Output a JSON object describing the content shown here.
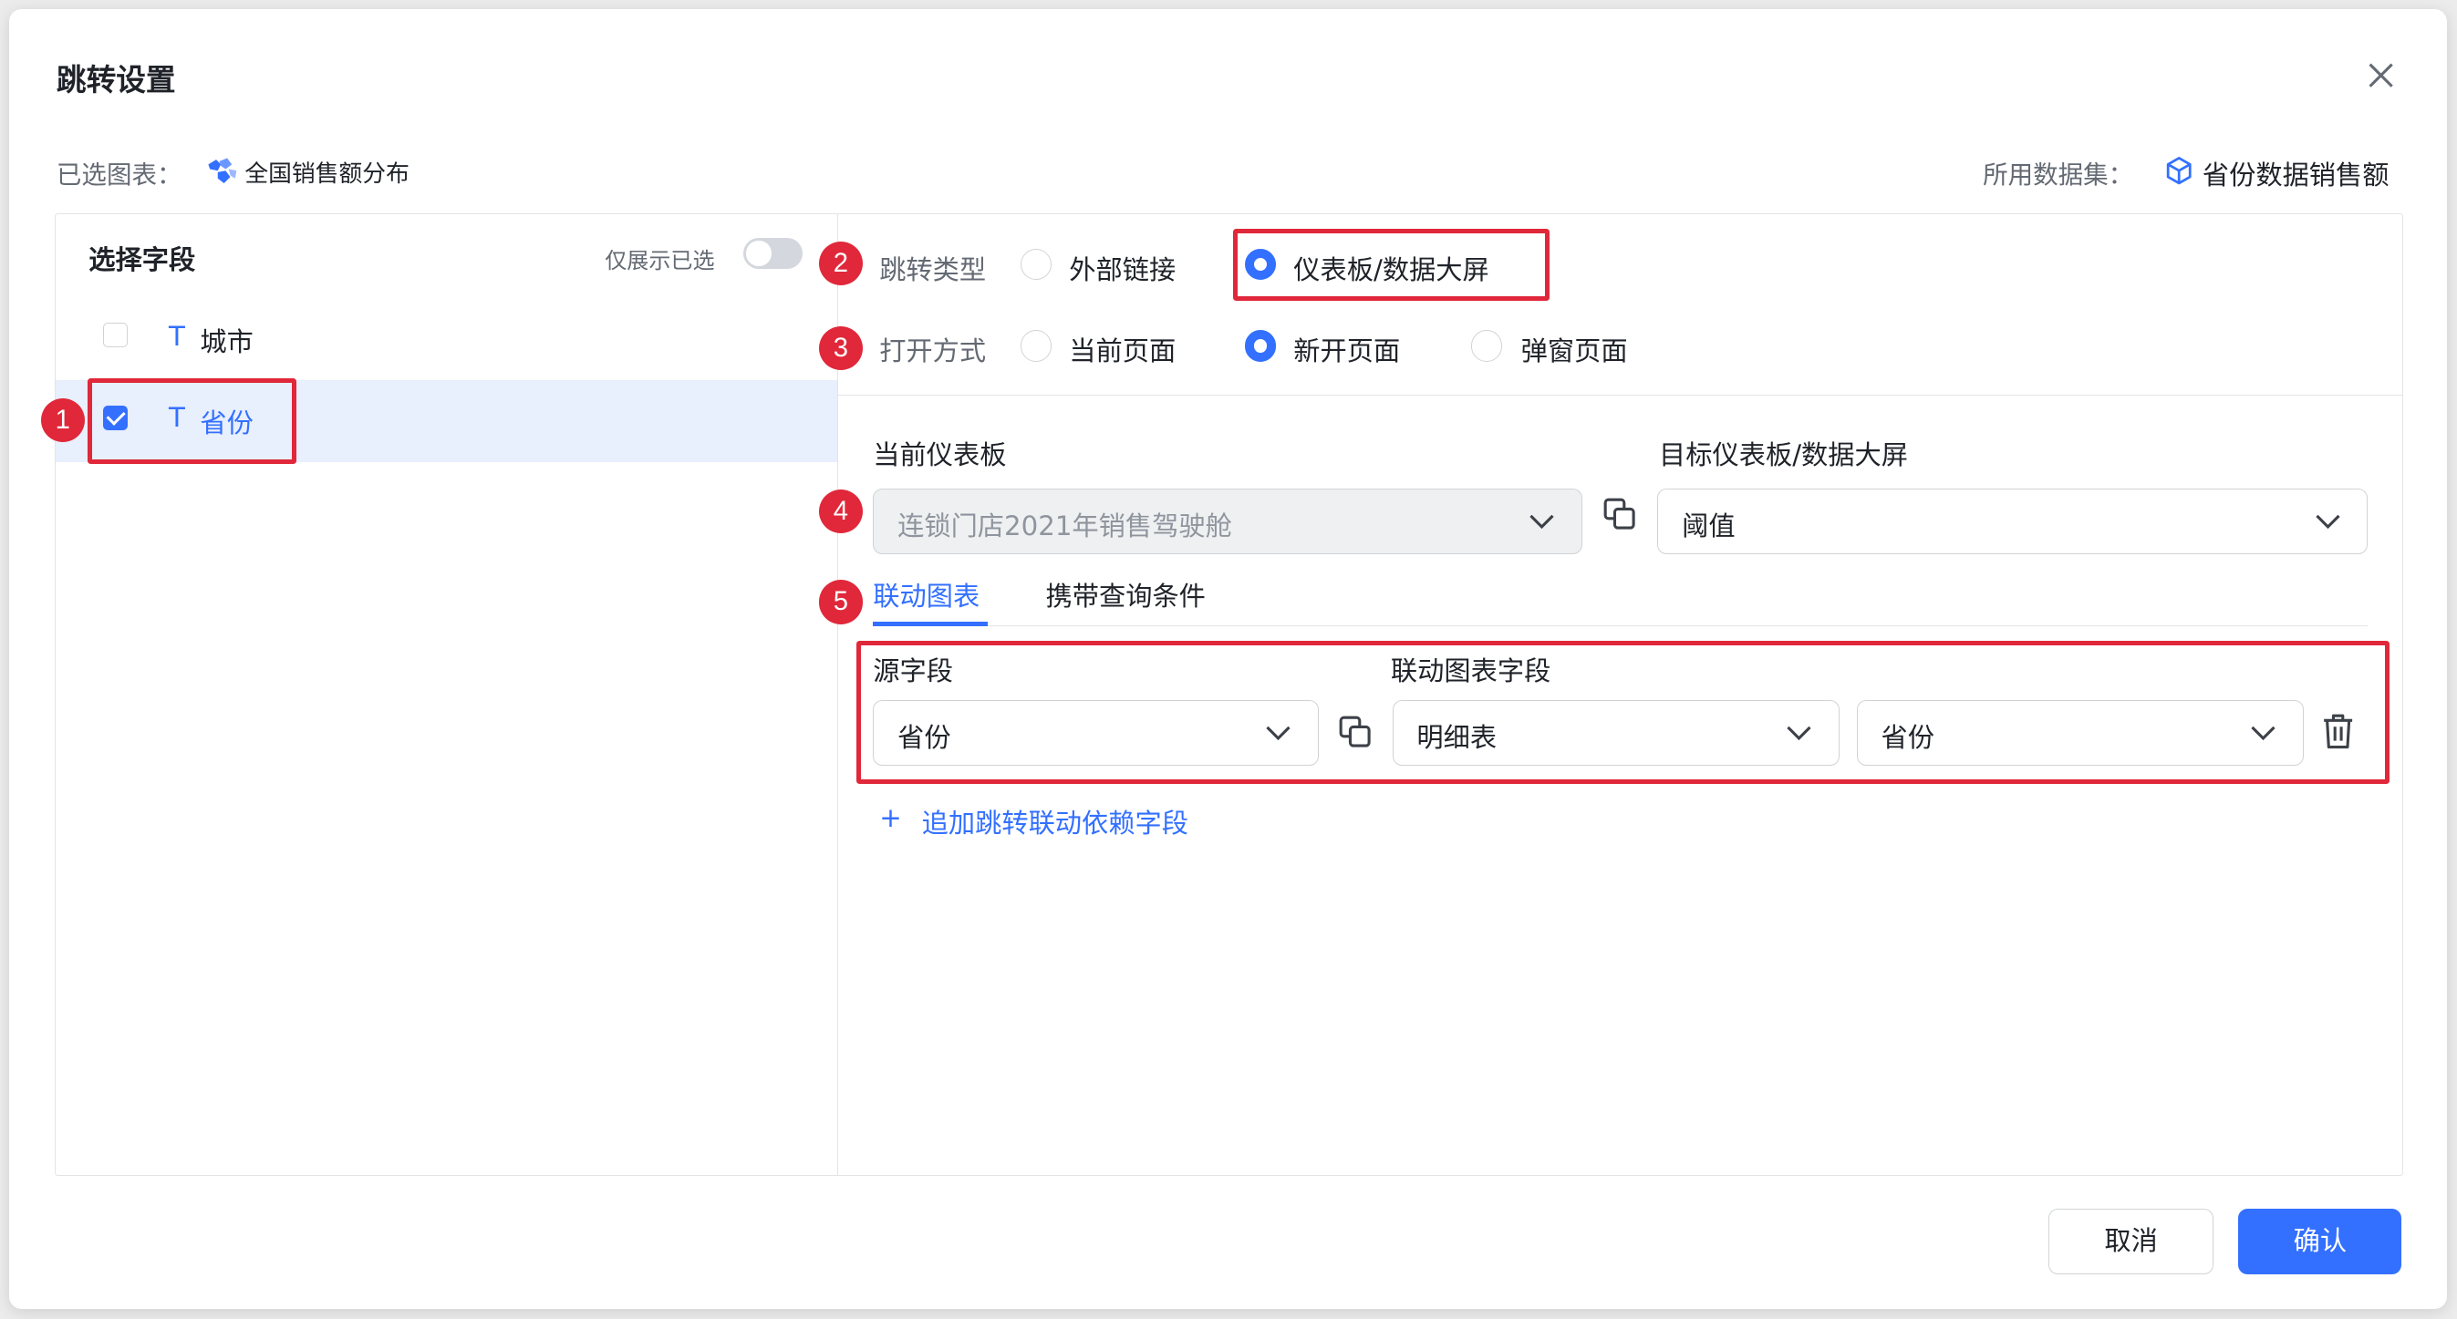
{
  "dialog": {
    "title": "跳转设置",
    "selected_chart_label": "已选图表：",
    "selected_chart_name": "全国销售额分布",
    "dataset_label": "所用数据集：",
    "dataset_name": "省份数据销售额"
  },
  "left_panel": {
    "heading": "选择字段",
    "only_selected_label": "仅展示已选",
    "only_selected_on": false,
    "fields": [
      {
        "type_icon": "T",
        "label": "城市",
        "checked": false
      },
      {
        "type_icon": "T",
        "label": "省份",
        "checked": true
      }
    ]
  },
  "badges": [
    "1",
    "2",
    "3",
    "4",
    "5"
  ],
  "jump_type": {
    "label": "跳转类型",
    "options": [
      {
        "label": "外部链接",
        "selected": false
      },
      {
        "label": "仪表板/数据大屏",
        "selected": true
      }
    ]
  },
  "open_mode": {
    "label": "打开方式",
    "options": [
      {
        "label": "当前页面",
        "selected": false
      },
      {
        "label": "新开页面",
        "selected": true
      },
      {
        "label": "弹窗页面",
        "selected": false
      }
    ]
  },
  "dashboards": {
    "current_label": "当前仪表板",
    "current_value": "连锁门店2021年销售驾驶舱",
    "target_label": "目标仪表板/数据大屏",
    "target_value": "阈值"
  },
  "tabs": [
    {
      "label": "联动图表",
      "active": true
    },
    {
      "label": "携带查询条件",
      "active": false
    }
  ],
  "mapping": {
    "source_label": "源字段",
    "target_label": "联动图表字段",
    "source_value": "省份",
    "chart_value": "明细表",
    "field_value": "省份"
  },
  "add_link": {
    "icon": "+",
    "label": "追加跳转联动依赖字段"
  },
  "footer": {
    "cancel": "取消",
    "confirm": "确认"
  },
  "colors": {
    "accent": "#3370ff",
    "highlight": "#e0283a",
    "selected_bg": "#e8effd"
  }
}
